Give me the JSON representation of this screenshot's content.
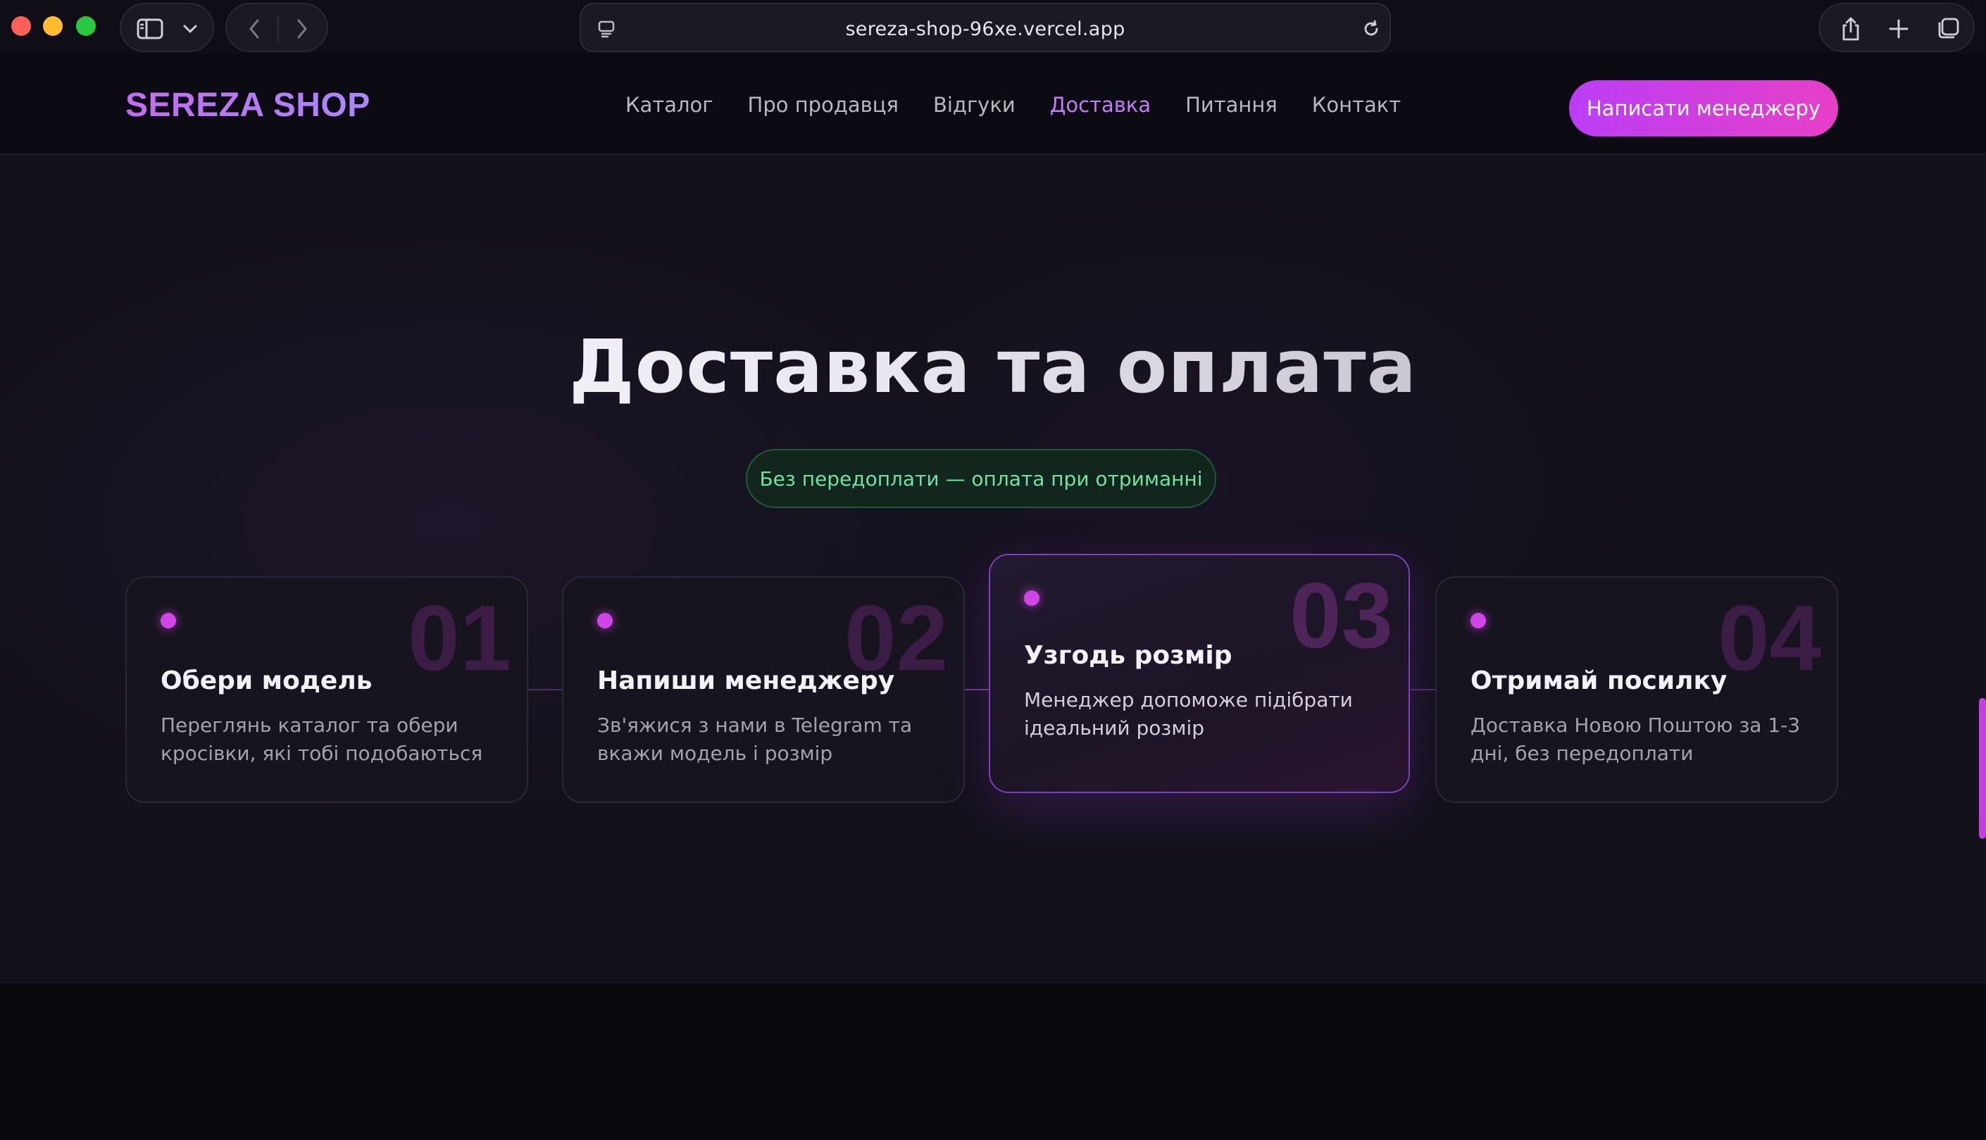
{
  "browser": {
    "url": "sereza-shop-96xe.vercel.app"
  },
  "header": {
    "logo": "SEREZA SHOP",
    "nav": [
      {
        "label": "Каталог"
      },
      {
        "label": "Про продавця"
      },
      {
        "label": "Відгуки"
      },
      {
        "label": "Доставка",
        "active": true
      },
      {
        "label": "Питання"
      },
      {
        "label": "Контакт"
      }
    ],
    "cta": "Написати менеджеру"
  },
  "section": {
    "title": "Доставка та оплата",
    "badge": "Без передоплати — оплата при отриманні",
    "steps": [
      {
        "number": "01",
        "title": "Обери модель",
        "desc": "Переглянь каталог та обери кросівки, які тобі подобаються"
      },
      {
        "number": "02",
        "title": "Напиши менеджеру",
        "desc": "Зв'яжися з нами в Telegram та вкажи модель і розмір"
      },
      {
        "number": "03",
        "title": "Узгодь розмір",
        "desc": "Менеджер допоможе підібрати ідеальний розмір"
      },
      {
        "number": "04",
        "title": "Отримай посилку",
        "desc": "Доставка Новою Поштою за 1-3 дні, без передоплати"
      }
    ]
  },
  "colors": {
    "accent": "#c07ef4",
    "cta_gradient_start": "#bb3ef5",
    "cta_gradient_end": "#e63fc7",
    "badge_text": "#6fe2a4"
  }
}
